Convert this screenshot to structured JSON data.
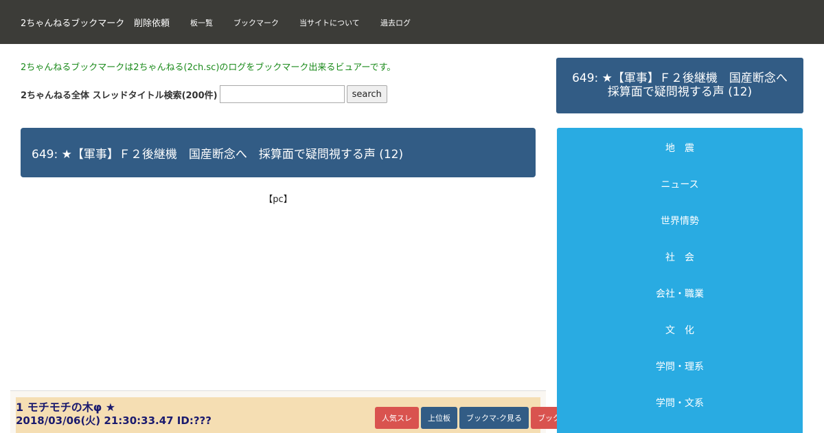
{
  "nav": {
    "brand": "2ちゃんねるブックマーク",
    "delete_request": "削除依頼",
    "links": [
      "板一覧",
      "ブックマーク",
      "当サイトについて",
      "過去ログ"
    ]
  },
  "intro": "2ちゃんねるブックマークは2ちゃんねる(2ch.sc)のログをブックマーク出来るビュアーです。",
  "search": {
    "label": "2ちゃんねる全体 スレッドタイトル検索(200件)",
    "value": "",
    "button": "search"
  },
  "thread": {
    "title": "649: ★【軍事】Ｆ２後継機　国産断念へ　採算面で疑問視する声 (12)",
    "device_tag": "【pc】"
  },
  "post": {
    "number_name": "1 モチモチの木φ ★",
    "date_id": "2018/03/06(火) 21:30:33.47 ID:???"
  },
  "actions": {
    "popular": "人気スレ",
    "upper_board": "上位板",
    "view_bookmarks": "ブックマ-ク見る",
    "bookmark": "ブックマ-クする"
  },
  "sidebar": {
    "title": "649: ★【軍事】Ｆ２後継機　国産断念へ　採算面で疑問視する声 (12)",
    "categories": [
      "地　震",
      "ニュース",
      "世界情勢",
      "社　会",
      "会社・職業",
      "文　化",
      "学問・理系",
      "学問・文系"
    ]
  },
  "colors": {
    "navbar": "#3c3c38",
    "header_blue": "#325c85",
    "menu_blue": "#29abe2",
    "intro_green": "#1a8a1a",
    "post_bg": "#f5deb3",
    "button_red": "#d9534f"
  }
}
